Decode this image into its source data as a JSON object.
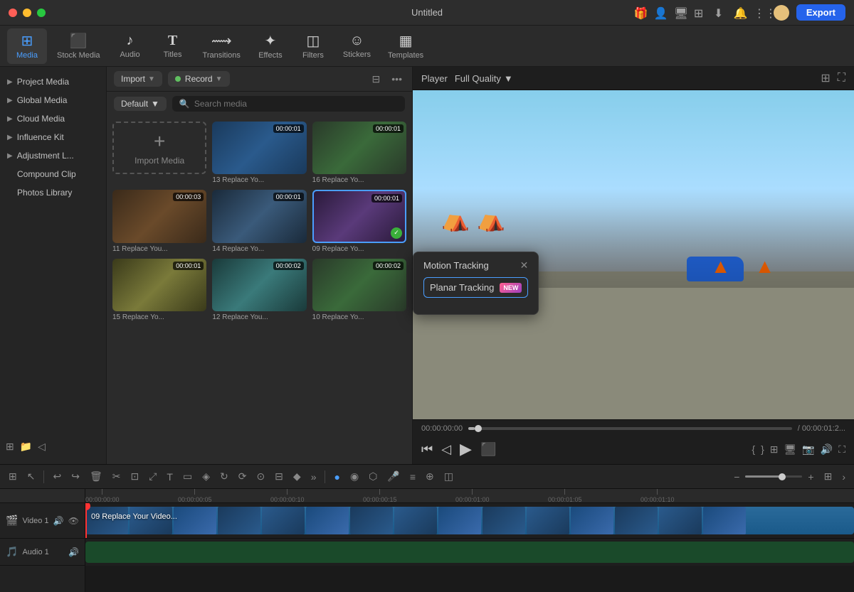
{
  "app": {
    "title": "Untitled"
  },
  "titlebar": {
    "export_label": "Export"
  },
  "toolbar": {
    "items": [
      {
        "id": "media",
        "icon": "🖼",
        "label": "Media",
        "active": true
      },
      {
        "id": "stock-media",
        "icon": "📦",
        "label": "Stock Media",
        "active": false
      },
      {
        "id": "audio",
        "icon": "🎵",
        "label": "Audio",
        "active": false
      },
      {
        "id": "titles",
        "icon": "T",
        "label": "Titles",
        "active": false
      },
      {
        "id": "transitions",
        "icon": "↗",
        "label": "Transitions",
        "active": false
      },
      {
        "id": "effects",
        "icon": "✨",
        "label": "Effects",
        "active": false
      },
      {
        "id": "filters",
        "icon": "🔲",
        "label": "Filters",
        "active": false
      },
      {
        "id": "stickers",
        "icon": "😊",
        "label": "Stickers",
        "active": false
      },
      {
        "id": "templates",
        "icon": "▦",
        "label": "Templates",
        "active": false
      }
    ]
  },
  "sidebar": {
    "items": [
      {
        "label": "Project Media",
        "id": "project-media"
      },
      {
        "label": "Global Media",
        "id": "global-media"
      },
      {
        "label": "Cloud Media",
        "id": "cloud-media"
      },
      {
        "label": "Influence Kit",
        "id": "influence-kit"
      },
      {
        "label": "Adjustment L...",
        "id": "adjustment-l"
      },
      {
        "label": "Compound Clip",
        "id": "compound-clip"
      },
      {
        "label": "Photos Library",
        "id": "photos-library"
      }
    ]
  },
  "media_toolbar": {
    "import_label": "Import",
    "record_label": "Record"
  },
  "media_grid": {
    "search_placeholder": "Search media",
    "default_label": "Default",
    "items": [
      {
        "id": "import",
        "type": "import",
        "label": "Import Media"
      },
      {
        "id": "v1",
        "type": "video",
        "duration": "00:00:01",
        "name": "13 Replace Yo...",
        "colorClass": "vt1"
      },
      {
        "id": "v2",
        "type": "video",
        "duration": "00:00:01",
        "name": "16 Replace Yo...",
        "colorClass": "vt2"
      },
      {
        "id": "v3",
        "type": "video",
        "duration": "00:00:03",
        "name": "11 Replace You...",
        "colorClass": "vt3"
      },
      {
        "id": "v4",
        "type": "video",
        "duration": "00:00:01",
        "name": "14 Replace Yo...",
        "colorClass": "vt4",
        "selected": false
      },
      {
        "id": "v5",
        "type": "video",
        "duration": "00:00:01",
        "name": "09 Replace Yo...",
        "colorClass": "vt5",
        "selected": true,
        "checked": true
      },
      {
        "id": "v6",
        "type": "video",
        "duration": "00:00:01",
        "name": "15 Replace Yo...",
        "colorClass": "vt6"
      },
      {
        "id": "v7",
        "type": "video",
        "duration": "00:00:02",
        "name": "12 Replace You...",
        "colorClass": "vt7"
      },
      {
        "id": "v8",
        "type": "video",
        "duration": "00:00:02",
        "name": "10 Replace Yo...",
        "colorClass": "vt2"
      }
    ]
  },
  "preview": {
    "player_label": "Player",
    "quality_label": "Full Quality",
    "time_current": "00:00:00:00",
    "time_total": "/ 00:00:01:2..."
  },
  "timeline": {
    "ruler_marks": [
      "00:00:00:00",
      "00:00:00:05",
      "00:00:00:10",
      "00:00:00:15",
      "00:00:01:00",
      "00:00:01:05",
      "00:00:01:10"
    ],
    "track1_label": "Video 1",
    "track1_icon": "🎬",
    "track2_label": "Audio 1",
    "track2_icon": "🎵",
    "clip_name": "09 Replace Your Video..."
  },
  "motion_popup": {
    "title": "Motion Tracking",
    "close_icon": "✕",
    "item_label": "Planar Tracking",
    "item_badge": "NEW"
  }
}
